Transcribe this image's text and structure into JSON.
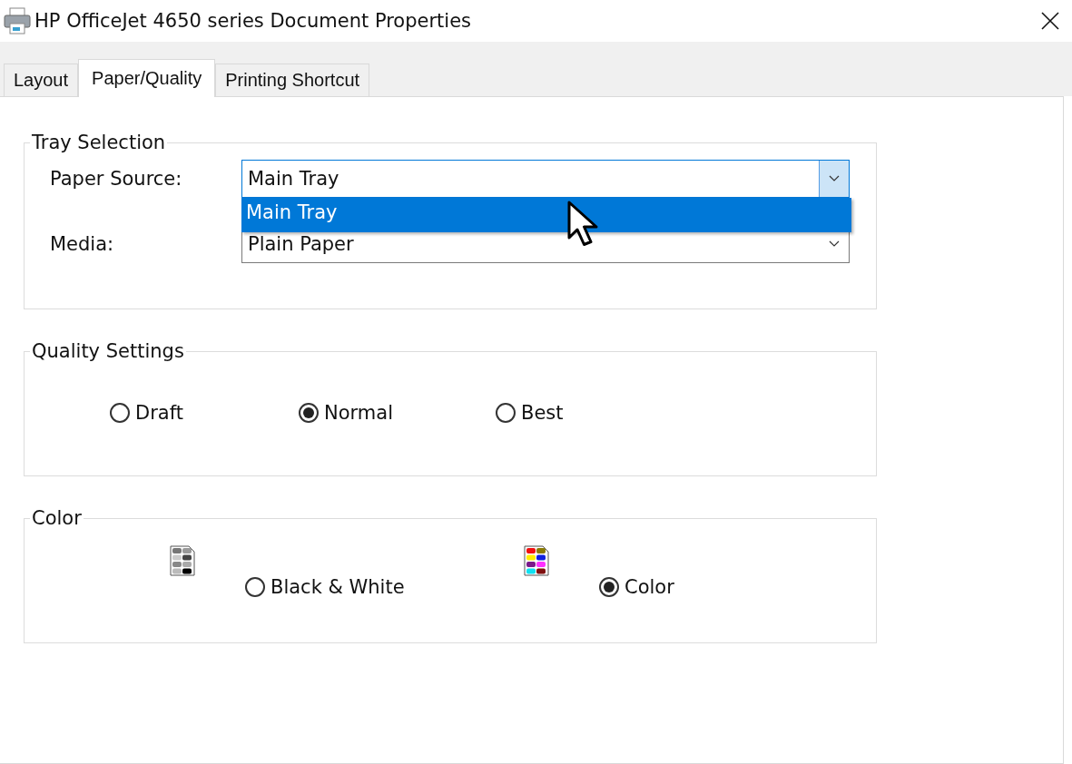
{
  "window": {
    "title": "HP OfficeJet 4650 series Document Properties"
  },
  "tabs": [
    {
      "label": "Layout",
      "selected": false
    },
    {
      "label": "Paper/Quality",
      "selected": true
    },
    {
      "label": "Printing Shortcut",
      "selected": false
    }
  ],
  "tray_selection": {
    "title": "Tray Selection",
    "fields": [
      {
        "label": "Paper Source:",
        "value": "Main Tray",
        "open": true
      },
      {
        "label": "Media:",
        "value": "Plain Paper",
        "open": false
      }
    ],
    "dropdown_options": [
      {
        "label": "Main Tray",
        "selected": true
      }
    ]
  },
  "quality_settings": {
    "title": "Quality Settings",
    "options": [
      {
        "label": "Draft",
        "selected": false
      },
      {
        "label": "Normal",
        "selected": true
      },
      {
        "label": "Best",
        "selected": false
      }
    ]
  },
  "color": {
    "title": "Color",
    "options": [
      {
        "label": "Black & White",
        "kind": "grayscale",
        "selected": false
      },
      {
        "label": "Color",
        "kind": "color",
        "selected": true
      }
    ]
  }
}
